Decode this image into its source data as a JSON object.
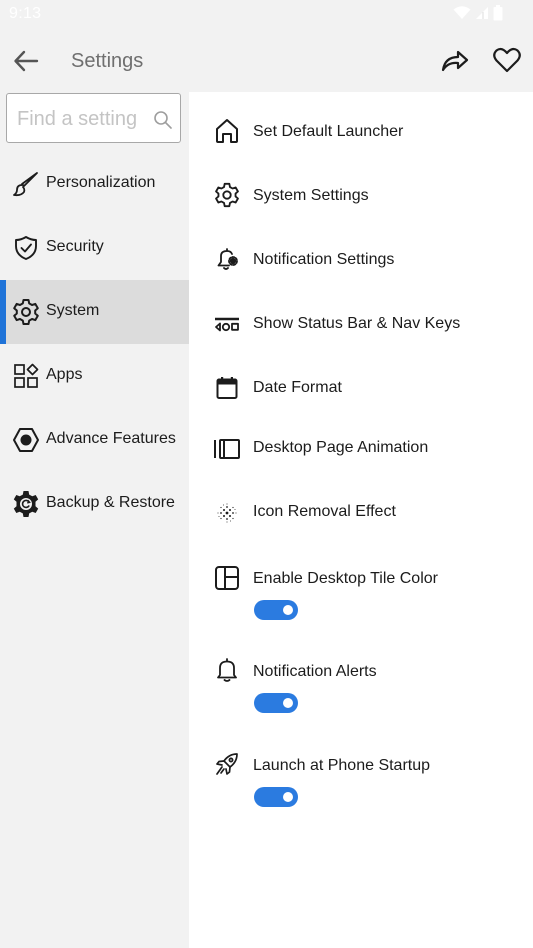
{
  "status_bar": {
    "time": "9:13"
  },
  "app_bar": {
    "title": "Settings"
  },
  "search": {
    "placeholder": "Find a setting"
  },
  "sidebar": {
    "items": [
      {
        "label": "Personalization",
        "icon": "brush-icon"
      },
      {
        "label": "Security",
        "icon": "shield-icon"
      },
      {
        "label": "System",
        "icon": "gear-icon",
        "active": true
      },
      {
        "label": "Apps",
        "icon": "apps-grid-icon"
      },
      {
        "label": "Advance Features",
        "icon": "hexagon-icon"
      },
      {
        "label": "Backup & Restore",
        "icon": "backup-gear-icon"
      }
    ]
  },
  "settings": [
    {
      "label": "Set Default Launcher",
      "icon": "home-icon"
    },
    {
      "label": "System Settings",
      "icon": "gear-icon"
    },
    {
      "label": "Notification Settings",
      "icon": "bell-gear-icon"
    },
    {
      "label": "Show Status Bar & Nav Keys",
      "icon": "nav-keys-icon"
    },
    {
      "label": "Date Format",
      "icon": "calendar-icon"
    },
    {
      "label": "Desktop Page Animation",
      "icon": "page-animation-icon"
    },
    {
      "label": "Icon Removal Effect",
      "icon": "sparkle-dots-icon"
    },
    {
      "label": "Enable Desktop Tile Color",
      "icon": "tile-layout-icon",
      "toggle": true
    },
    {
      "label": "Notification Alerts",
      "icon": "bell-icon",
      "toggle": true
    },
    {
      "label": "Launch at Phone Startup",
      "icon": "rocket-icon",
      "toggle": true
    }
  ],
  "colors": {
    "accent": "#1f73d8",
    "toggle_on": "#2b7be0",
    "sidebar_bg": "#f2f2f2",
    "selected_bg": "#dcdcdc"
  }
}
